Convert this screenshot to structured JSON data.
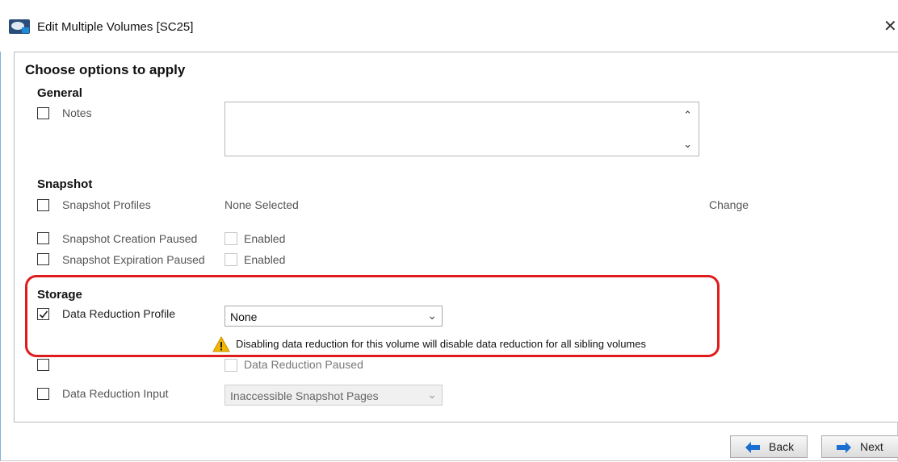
{
  "window": {
    "title": "Edit Multiple Volumes  [SC25]",
    "close_symbol": "✕"
  },
  "main": {
    "heading": "Choose options to apply"
  },
  "general": {
    "heading": "General",
    "notes_label": "Notes"
  },
  "snapshot": {
    "heading": "Snapshot",
    "profiles_label": "Snapshot Profiles",
    "profiles_value": "None Selected",
    "change_link": "Change",
    "creation_paused_label": "Snapshot Creation Paused",
    "creation_enabled_label": "Enabled",
    "expiration_paused_label": "Snapshot Expiration Paused",
    "expiration_enabled_label": "Enabled"
  },
  "storage": {
    "heading": "Storage",
    "data_reduction_profile_label": "Data Reduction Profile",
    "data_reduction_profile_value": "None",
    "data_reduction_profile_checked": true,
    "warning_text": "Disabling data reduction for this volume will disable data reduction for all sibling volumes",
    "data_reduction_paused_label": "Data Reduction Paused",
    "data_reduction_input_label": "Data Reduction Input",
    "data_reduction_input_value": "Inaccessible Snapshot Pages"
  },
  "footer": {
    "back_label": "Back",
    "next_label": "Next"
  },
  "colors": {
    "highlight": "#e01b1b",
    "arrow_blue": "#1a6fd1",
    "warning": "#f2b600"
  }
}
